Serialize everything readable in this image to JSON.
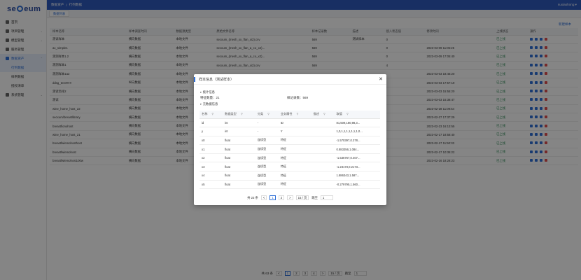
{
  "brand": {
    "left": "se",
    "right": "eum"
  },
  "sidebar": {
    "items": [
      {
        "label": "首页"
      },
      {
        "label": "项目管理"
      },
      {
        "label": "模型管理"
      },
      {
        "label": "服务管理"
      },
      {
        "label": "数据资产"
      },
      {
        "label": "行列数据"
      },
      {
        "label": "样例数据"
      },
      {
        "label": "授权清单"
      },
      {
        "label": "系统管理"
      }
    ]
  },
  "topbar": {
    "breadcrumb1": "数据资产",
    "sep": "/",
    "breadcrumb2": "行列数据",
    "user": "suxiaohong ▾"
  },
  "tabs": {
    "active": "数据列表"
  },
  "toolbar": {
    "new_label": "新建样本"
  },
  "table": {
    "headers": [
      "样本名称",
      "样本调查时间",
      "数据源类型",
      "原始文件名称",
      "样本记录数",
      "描述",
      "接入状态值",
      "修改时间",
      "上线状态",
      "操作"
    ],
    "rows": [
      [
        "测试样本",
        "横向数据",
        "本地文件",
        "secxum_(mesh_xx_flan_xi2).csv",
        "569",
        "测试样本",
        "0",
        "",
        "已上线"
      ],
      [
        "ax_simple1",
        "横向数据",
        "本地文件",
        "secxum_(mesh_xx_flan_a_co_x2)...",
        "569",
        "",
        "0",
        "2023-03-09 11:06:25",
        "已上线"
      ],
      [
        "测测样本1.2",
        "横向数据",
        "本地文件",
        "secxum_(mesh_xx_flan_a_co_x2)...",
        "569",
        "",
        "0",
        "2023-03-09 17:05:40",
        "已上线"
      ],
      [
        "测测样本1",
        "横向数据",
        "本地文件",
        "secxum_(mesh_xx_flan_xi2).csv",
        "569",
        "",
        "4",
        "",
        "已上线"
      ],
      [
        "测测样本1a2",
        "横向数据",
        "本地文件",
        "",
        "",
        "",
        "",
        "2023-03-03 18:45:20",
        "已上线"
      ],
      [
        "ddsg_test!!!!!!!",
        "纵向数据",
        "本地文件",
        "",
        "",
        "",
        "",
        "2023-03-03 17:57:19",
        "已上线"
      ],
      [
        "测试负样2",
        "横向数据",
        "本地文件",
        "",
        "",
        "",
        "",
        "2023-03-03 15:55:20",
        "已上线"
      ],
      [
        "测试",
        "横向数据",
        "本地文件",
        "",
        "",
        "",
        "",
        "2023-03-03 15:38:47",
        "已上线"
      ],
      [
        "wine_home_host_22",
        "横向数据",
        "本地文件",
        "",
        "",
        "",
        "",
        "2023-02-28 11:09:54",
        "已上线"
      ],
      [
        "secxum/breastlibrary",
        "横向数据",
        "本地文件",
        "",
        "",
        "",
        "",
        "2023-02-27 17:37:29",
        "已上线"
      ],
      [
        "breastfionohost",
        "横向数据",
        "本地文件",
        "",
        "",
        "",
        "",
        "2023-02-23 16:13:55",
        "已上线"
      ],
      [
        "wine_home_host_21",
        "横向数据",
        "本地文件",
        "",
        "",
        "",
        "",
        "2023-02-17 18:58:40",
        "已上线"
      ],
      [
        "breastfwlemohosthost",
        "横向数据",
        "本地文件",
        "",
        "",
        "",
        "",
        "2023-02-17 11:50:33",
        "已上线"
      ],
      [
        "breastfwlemohost",
        "横向数据",
        "本地文件",
        "",
        "",
        "",
        "",
        "2023-02-17 10:35:22",
        "已上线"
      ],
      [
        "breastfwlemohost100w",
        "横向数据",
        "本地文件",
        "",
        "",
        "",
        "",
        "2023-02-16 18:28:23",
        "已上线"
      ]
    ]
  },
  "pager": {
    "total": "共 63 条",
    "prev": "<",
    "pages": [
      "1",
      "2",
      "3",
      "4"
    ],
    "next": ">",
    "size": "15 / 页",
    "goto": "跳至",
    "goto_val": "1"
  },
  "modal": {
    "title": "样本信息（测试样本）",
    "close": "✕",
    "stats_section": "统计信息",
    "feature_count": "特征数量：21",
    "record_count": "样记录数：569",
    "meta_section": "元数据信息",
    "headers": [
      "名称",
      "数据类型",
      "分类",
      "业务属性",
      "描述",
      "取值"
    ],
    "rows": [
      [
        "id",
        "int",
        "-",
        "ID",
        "",
        "81,509,180,98,3..."
      ],
      [
        "y",
        "int",
        "-",
        "Y",
        "",
        "1,0,1,1,1,1,1,1,1,0..."
      ],
      [
        "x0",
        "float",
        "连续型",
        "特征",
        "",
        "-1.570397,0.378..."
      ],
      [
        "x1",
        "float",
        "连续型",
        "特征",
        "",
        "0.883356,1.084..."
      ],
      [
        "x2",
        "float",
        "连续型",
        "特征",
        "",
        "-1.536767,0.407..."
      ],
      [
        "x3",
        "float",
        "连续型",
        "特征",
        "",
        "-1.23173,0.2173..."
      ],
      [
        "x4",
        "float",
        "连续型",
        "特征",
        "",
        "1.886343,1.587..."
      ],
      [
        "x5",
        "float",
        "连续型",
        "特征",
        "",
        "-0.279795,1.560..."
      ]
    ],
    "pager": {
      "total": "共 23 条",
      "prev": "<",
      "pages": [
        "1",
        "2"
      ],
      "next": ">",
      "size": "15 / 页",
      "goto": "跳至",
      "goto_val": "1"
    }
  }
}
